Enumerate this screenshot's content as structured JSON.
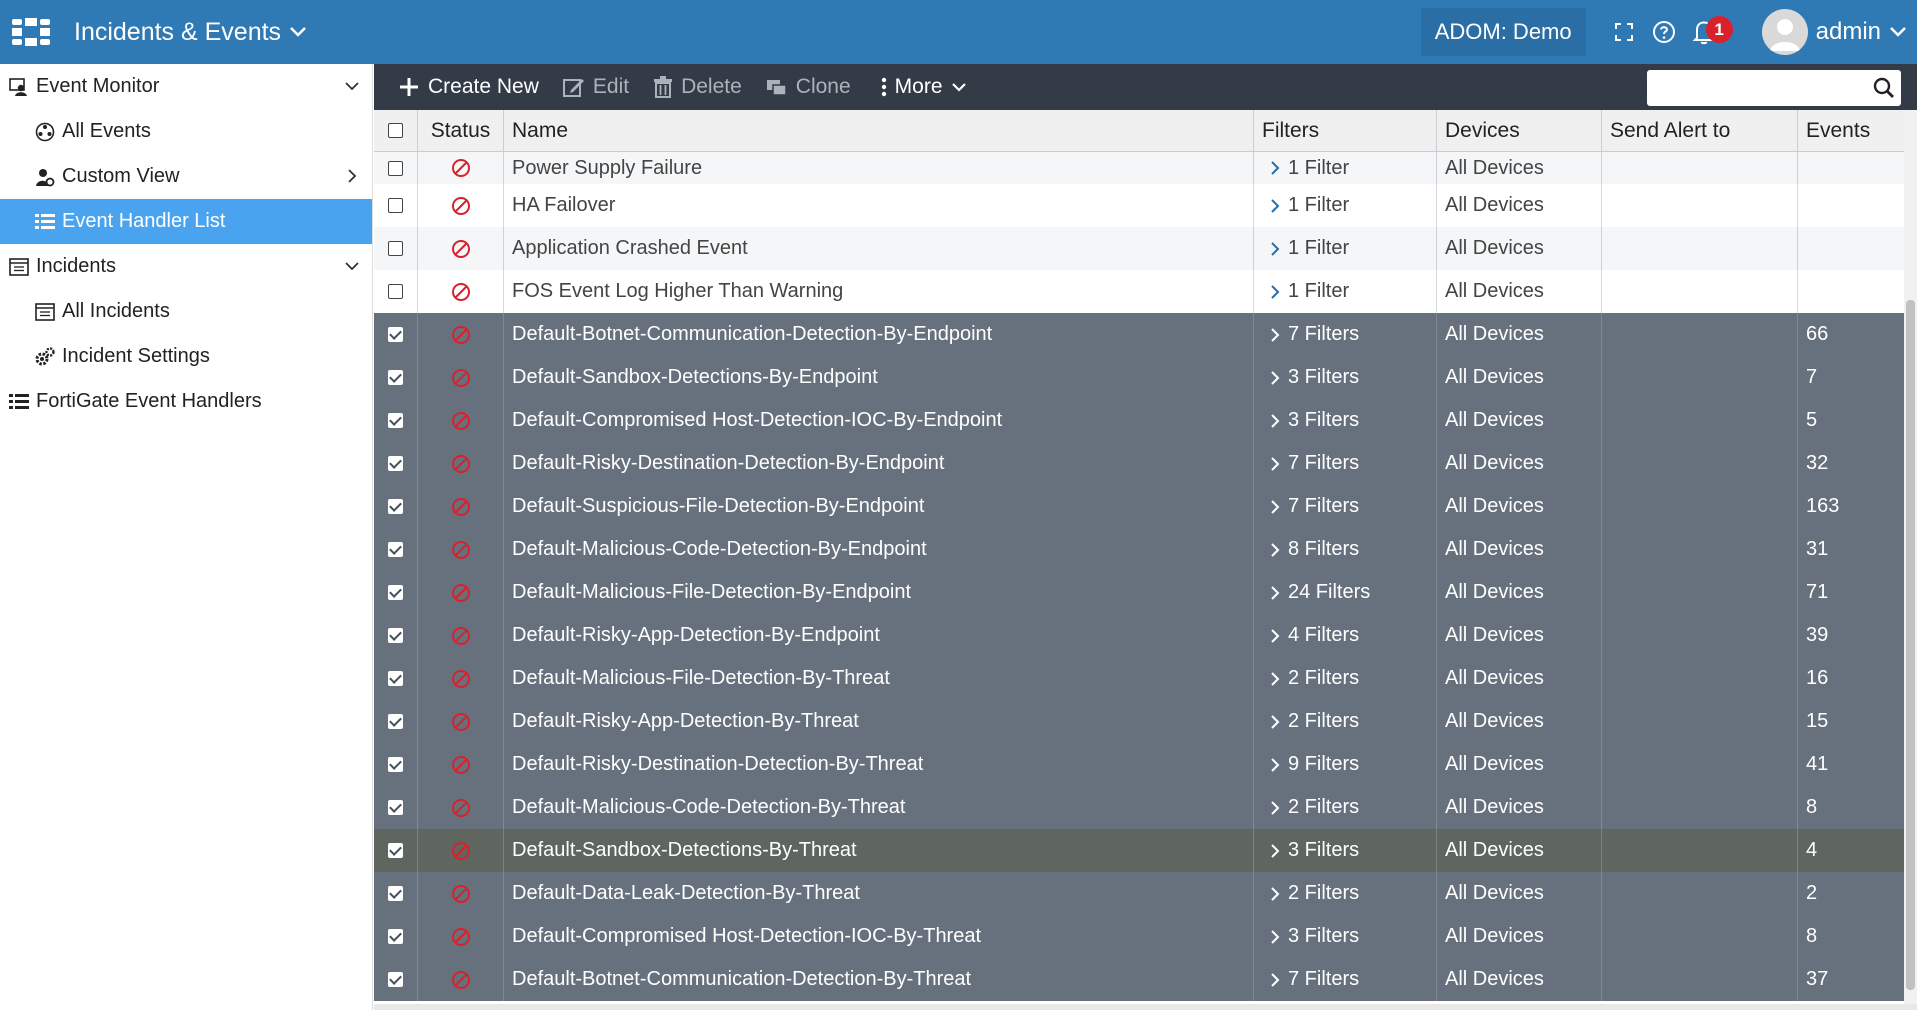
{
  "topbar": {
    "app_title": "Incidents & Events",
    "adom_label": "ADOM: Demo",
    "notification_count": "1",
    "user_name": "admin"
  },
  "sidebar": {
    "items": [
      {
        "label": "Event Monitor",
        "icon": "monitor-user-icon",
        "level": 0,
        "expand": "down"
      },
      {
        "label": "All Events",
        "icon": "globe-icon",
        "level": 1
      },
      {
        "label": "Custom View",
        "icon": "user-gear-icon",
        "level": 1,
        "expand": "right"
      },
      {
        "label": "Event Handler List",
        "icon": "list-icon",
        "level": 1,
        "active": true
      },
      {
        "label": "Incidents",
        "icon": "window-icon",
        "level": 0,
        "expand": "down"
      },
      {
        "label": "All Incidents",
        "icon": "window-icon",
        "level": 1
      },
      {
        "label": "Incident Settings",
        "icon": "gears-icon",
        "level": 1
      },
      {
        "label": "FortiGate Event Handlers",
        "icon": "list-icon",
        "level": 0
      }
    ]
  },
  "toolbar": {
    "create_new": "Create New",
    "edit": "Edit",
    "delete": "Delete",
    "clone": "Clone",
    "more": "More",
    "search_placeholder": ""
  },
  "table": {
    "headers": {
      "status": "Status",
      "name": "Name",
      "filters": "Filters",
      "devices": "Devices",
      "send_alert_to": "Send Alert to",
      "events": "Events"
    },
    "rows": [
      {
        "name": "Power Supply Failure",
        "filters": "1 Filter",
        "devices": "All Devices",
        "send_alert_to": "",
        "events": "",
        "checked": false
      },
      {
        "name": "HA Failover",
        "filters": "1 Filter",
        "devices": "All Devices",
        "send_alert_to": "",
        "events": "",
        "checked": false
      },
      {
        "name": "Application Crashed Event",
        "filters": "1 Filter",
        "devices": "All Devices",
        "send_alert_to": "",
        "events": "",
        "checked": false
      },
      {
        "name": "FOS Event Log Higher Than Warning",
        "filters": "1 Filter",
        "devices": "All Devices",
        "send_alert_to": "",
        "events": "",
        "checked": false
      },
      {
        "name": "Default-Botnet-Communication-Detection-By-Endpoint",
        "filters": "7 Filters",
        "devices": "All Devices",
        "send_alert_to": "",
        "events": "66",
        "checked": true
      },
      {
        "name": "Default-Sandbox-Detections-By-Endpoint",
        "filters": "3 Filters",
        "devices": "All Devices",
        "send_alert_to": "",
        "events": "7",
        "checked": true
      },
      {
        "name": "Default-Compromised Host-Detection-IOC-By-Endpoint",
        "filters": "3 Filters",
        "devices": "All Devices",
        "send_alert_to": "",
        "events": "5",
        "checked": true
      },
      {
        "name": "Default-Risky-Destination-Detection-By-Endpoint",
        "filters": "7 Filters",
        "devices": "All Devices",
        "send_alert_to": "",
        "events": "32",
        "checked": true
      },
      {
        "name": "Default-Suspicious-File-Detection-By-Endpoint",
        "filters": "7 Filters",
        "devices": "All Devices",
        "send_alert_to": "",
        "events": "163",
        "checked": true
      },
      {
        "name": "Default-Malicious-Code-Detection-By-Endpoint",
        "filters": "8 Filters",
        "devices": "All Devices",
        "send_alert_to": "",
        "events": "31",
        "checked": true
      },
      {
        "name": "Default-Malicious-File-Detection-By-Endpoint",
        "filters": "24 Filters",
        "devices": "All Devices",
        "send_alert_to": "",
        "events": "71",
        "checked": true
      },
      {
        "name": "Default-Risky-App-Detection-By-Endpoint",
        "filters": "4 Filters",
        "devices": "All Devices",
        "send_alert_to": "",
        "events": "39",
        "checked": true
      },
      {
        "name": "Default-Malicious-File-Detection-By-Threat",
        "filters": "2 Filters",
        "devices": "All Devices",
        "send_alert_to": "",
        "events": "16",
        "checked": true
      },
      {
        "name": "Default-Risky-App-Detection-By-Threat",
        "filters": "2 Filters",
        "devices": "All Devices",
        "send_alert_to": "",
        "events": "15",
        "checked": true
      },
      {
        "name": "Default-Risky-Destination-Detection-By-Threat",
        "filters": "9 Filters",
        "devices": "All Devices",
        "send_alert_to": "",
        "events": "41",
        "checked": true
      },
      {
        "name": "Default-Malicious-Code-Detection-By-Threat",
        "filters": "2 Filters",
        "devices": "All Devices",
        "send_alert_to": "",
        "events": "8",
        "checked": true
      },
      {
        "name": "Default-Sandbox-Detections-By-Threat",
        "filters": "3 Filters",
        "devices": "All Devices",
        "send_alert_to": "",
        "events": "4",
        "checked": true,
        "hover": true
      },
      {
        "name": "Default-Data-Leak-Detection-By-Threat",
        "filters": "2 Filters",
        "devices": "All Devices",
        "send_alert_to": "",
        "events": "2",
        "checked": true
      },
      {
        "name": "Default-Compromised Host-Detection-IOC-By-Threat",
        "filters": "3 Filters",
        "devices": "All Devices",
        "send_alert_to": "",
        "events": "8",
        "checked": true
      },
      {
        "name": "Default-Botnet-Communication-Detection-By-Threat",
        "filters": "7 Filters",
        "devices": "All Devices",
        "send_alert_to": "",
        "events": "37",
        "checked": true
      }
    ]
  },
  "colors": {
    "topbar": "#2f79b4",
    "toolbar": "#323b46",
    "selected_row": "#66717d",
    "active_nav": "#4aa3ef",
    "disabled_status": "#d9212b"
  }
}
